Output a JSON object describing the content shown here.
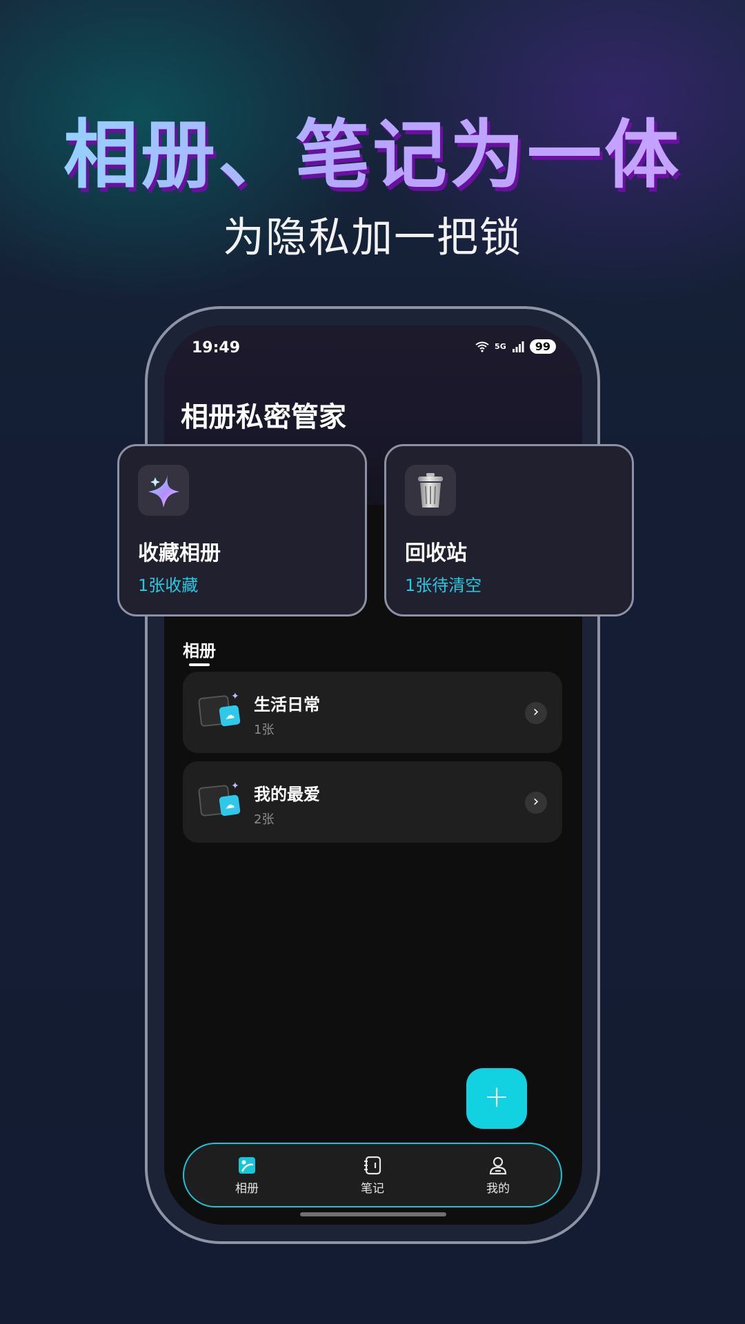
{
  "promo": {
    "headline": "相册、笔记为一体",
    "subline": "为隐私加一把锁"
  },
  "status_bar": {
    "time": "19:49",
    "network": "5G",
    "battery": "99"
  },
  "app": {
    "title": "相册私密管家"
  },
  "cards": [
    {
      "title": "收藏相册",
      "subtitle": "1张收藏",
      "icon": "sparkle-icon"
    },
    {
      "title": "回收站",
      "subtitle": "1张待清空",
      "icon": "trash-icon"
    }
  ],
  "section": {
    "label": "相册"
  },
  "albums": [
    {
      "name": "生活日常",
      "count": "1张"
    },
    {
      "name": "我的最爱",
      "count": "2张"
    }
  ],
  "fab": {
    "symbol": "+"
  },
  "tabs": [
    {
      "label": "相册",
      "icon": "album-icon",
      "active": true
    },
    {
      "label": "笔记",
      "icon": "notebook-icon",
      "active": false
    },
    {
      "label": "我的",
      "icon": "profile-icon",
      "active": false
    }
  ],
  "colors": {
    "accent": "#12d1e0",
    "card_border": "#8c91a6",
    "background": "#141d33"
  }
}
